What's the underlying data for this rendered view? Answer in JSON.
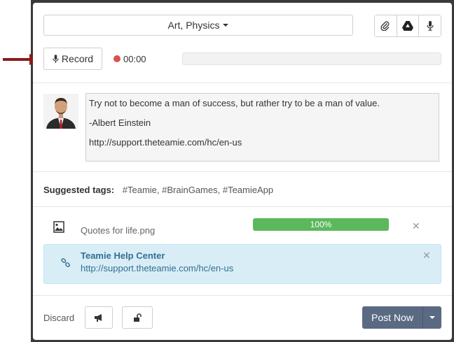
{
  "composer": {
    "course_select": "Art, Physics",
    "toolbar": {
      "attach_icon": "paperclip-icon",
      "drive_icon": "google-drive-icon",
      "mic_icon": "microphone-icon"
    },
    "record": {
      "label": "Record",
      "time": "00:00"
    },
    "post_text": {
      "line1": "Try not to become a man of success, but rather try to be a man of value.",
      "line2": "-Albert Einstein",
      "line3": "http://support.theteamie.com/hc/en-us"
    },
    "suggested_tags": {
      "label": "Suggested tags:",
      "tags": [
        "#Teamie,",
        "#BrainGames,",
        "#TeamieApp"
      ]
    },
    "attachment": {
      "file_name": "Quotes for life.png",
      "progress_label": "100%",
      "progress": 1.0
    },
    "link_preview": {
      "title": "Teamie Help Center",
      "url": "http://support.theteamie.com/hc/en-us"
    },
    "footer": {
      "discard": "Discard",
      "post_now": "Post Now"
    }
  },
  "colors": {
    "record_dot": "#d9534f",
    "progress_fill": "#5cb85c",
    "link_bg": "#d9edf7",
    "post_button": "#5a6a82",
    "arrow": "#8b1a1a"
  }
}
